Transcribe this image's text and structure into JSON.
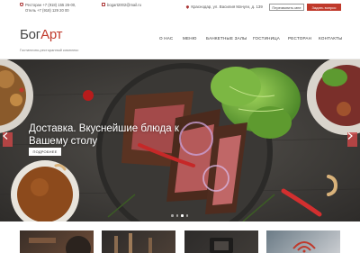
{
  "topbar": {
    "phone1": "Ресторан +7 (918) 155 26-00,",
    "phone2": "Отель +7 (918) 129 20 00",
    "email": "bogart2002@mail.ru",
    "address": "Краснодар, ул. Василия Мачуги, д. 139",
    "callback_label": "Перезвонить мне",
    "ask_label": "Задать вопрос"
  },
  "header": {
    "logo_part1": "Бог",
    "logo_part2": "Арт",
    "tagline": "Гостинично-ресторанный комплекс"
  },
  "nav": [
    "О НАС",
    "МЕНЮ",
    "БАНКЕТНЫЕ ЗАЛЫ",
    "ГОСТИНИЦА",
    "РЕСТОРАН",
    "КОНТАКТЫ"
  ],
  "hero": {
    "title": "Доставка. Вкуснейшие блюда к Вашему столу",
    "button_label": "ПОДРОБНЕЕ",
    "slides": 4,
    "active_slide": 2
  },
  "colors": {
    "accent": "#c0392b",
    "hero_bg": "#3f3d3a"
  },
  "icons": {
    "prev": "chevron-left-icon",
    "next": "chevron-right-icon",
    "phone": "phone-icon",
    "mail": "mail-icon",
    "pin": "map-pin-icon"
  }
}
